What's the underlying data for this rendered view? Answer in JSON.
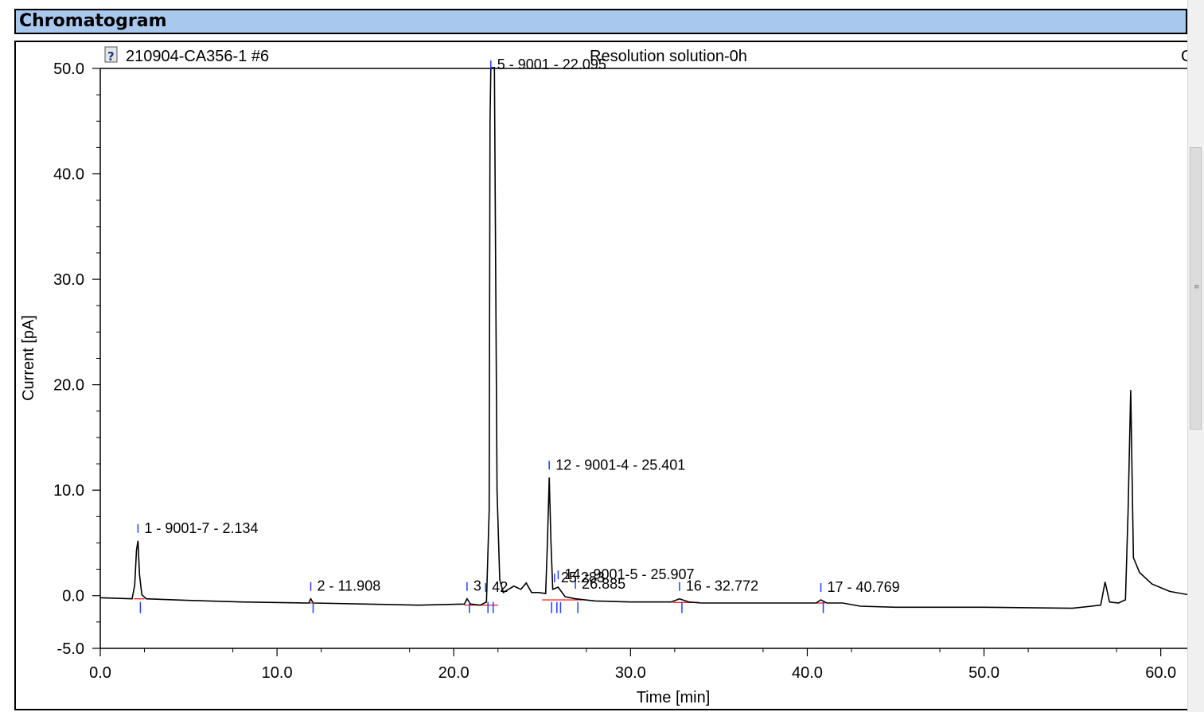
{
  "panel": {
    "title": "Chromatogram"
  },
  "chart_data": {
    "type": "line",
    "sample_id": "210904-CA356-1 #6",
    "sample_name": "Resolution solution-0h",
    "header_right": "C",
    "xlabel": "Time [min]",
    "ylabel": "Current [pA]",
    "xlim": [
      0,
      61.5
    ],
    "ylim": [
      -5,
      50
    ],
    "x_ticks": [
      0,
      10,
      20,
      30,
      40,
      50,
      60
    ],
    "x_tick_labels": [
      "0.0",
      "10.0",
      "20.0",
      "30.0",
      "40.0",
      "50.0",
      "60.0"
    ],
    "y_ticks": [
      -5,
      0,
      10,
      20,
      30,
      40,
      50
    ],
    "y_tick_labels": [
      "-5.0",
      "0.0",
      "10.0",
      "20.0",
      "30.0",
      "40.0",
      "50.0"
    ],
    "colors": {
      "trace": "#000000",
      "baseline": "#ff2a2a",
      "marker": "#1f3fff"
    },
    "trace": {
      "x": [
        0,
        1.8,
        1.95,
        2.05,
        2.134,
        2.22,
        2.35,
        2.6,
        5,
        8,
        11.8,
        11.908,
        12.05,
        15,
        18,
        20.6,
        20.75,
        20.95,
        21.5,
        21.85,
        22.0,
        22.05,
        22.095,
        22.3,
        22.45,
        22.6,
        22.8,
        23.4,
        23.8,
        24.1,
        24.4,
        24.8,
        25.2,
        25.3,
        25.401,
        25.5,
        25.6,
        25.907,
        26.3,
        26.885,
        28,
        30,
        32.3,
        32.772,
        33.3,
        34,
        37,
        40.5,
        40.769,
        41.1,
        42,
        43,
        45,
        50,
        55,
        56.6,
        56.85,
        57.1,
        57.6,
        58.0,
        58.15,
        58.3,
        58.45,
        58.8,
        59.5,
        60.5,
        61.5
      ],
      "y": [
        -0.2,
        -0.3,
        1.0,
        4.3,
        5.2,
        2.0,
        0.1,
        -0.3,
        -0.45,
        -0.6,
        -0.7,
        -0.3,
        -0.7,
        -0.8,
        -0.9,
        -0.8,
        -0.3,
        -0.8,
        -0.9,
        -0.6,
        8,
        45,
        58,
        52,
        10,
        1.5,
        0.3,
        0.9,
        0.6,
        1.2,
        0.3,
        0.3,
        0.2,
        5,
        11.2,
        5,
        0.6,
        0.8,
        -0.1,
        -0.3,
        -0.5,
        -0.6,
        -0.6,
        -0.3,
        -0.6,
        -0.7,
        -0.7,
        -0.7,
        -0.4,
        -0.7,
        -0.7,
        -1.0,
        -1.1,
        -1.1,
        -1.2,
        -0.9,
        1.3,
        -0.6,
        -0.7,
        -0.4,
        8,
        19.5,
        3.6,
        2.2,
        1.1,
        0.4,
        0.1
      ]
    },
    "peaks": [
      {
        "label": "1 - 9001-7 - 2.134",
        "rt": 2.134,
        "height": 5.2
      },
      {
        "label": "2 - 11.908",
        "rt": 11.908,
        "height": -0.3
      },
      {
        "label": "3",
        "rt": 20.75,
        "height": -0.3
      },
      {
        "label": "42",
        "rt": 21.8,
        "height": -0.4
      },
      {
        "label": "5 - 9001 - 22.095",
        "rt": 22.095,
        "height": 50
      },
      {
        "label": "12 - 9001-4 - 25.401",
        "rt": 25.401,
        "height": 11.2
      },
      {
        "label": "14 - 9001-5 - 25.907",
        "rt": 25.907,
        "height": 0.8
      },
      {
        "label": "25.283",
        "rt": 25.7,
        "height": 0.5
      },
      {
        "label": "26.885",
        "rt": 26.885,
        "height": -0.1
      },
      {
        "label": "16 - 32.772",
        "rt": 32.772,
        "height": -0.3
      },
      {
        "label": "17 - 40.769",
        "rt": 40.769,
        "height": -0.4
      }
    ]
  }
}
